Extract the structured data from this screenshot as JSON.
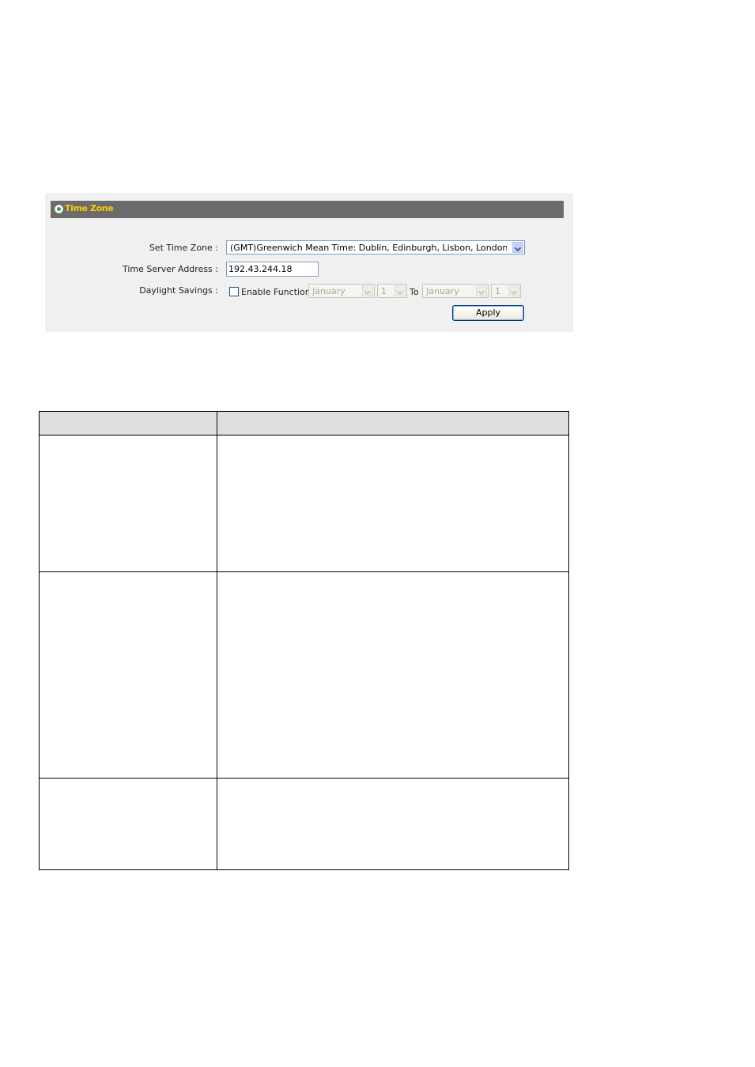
{
  "panel": {
    "title": "Time Zone",
    "set_time_zone_label": "Set Time Zone :",
    "time_zone_value": "(GMT)Greenwich Mean Time: Dublin, Edinburgh, Lisbon, London",
    "time_server_label": "Time Server Address :",
    "time_server_value": "192.43.244.18",
    "daylight_label": "Daylight Savings :",
    "enable_function_label": "Enable Function",
    "enable_function_checked": false,
    "start_month": "January",
    "start_day": "1",
    "to_label": "To",
    "end_month": "January",
    "end_day": "1",
    "apply_label": "Apply"
  },
  "colors": {
    "header_bg": "#6b6b6b",
    "header_text": "#ffcc00",
    "panel_bg": "#f0f0f0",
    "table_header_bg": "#dfdfdf"
  }
}
